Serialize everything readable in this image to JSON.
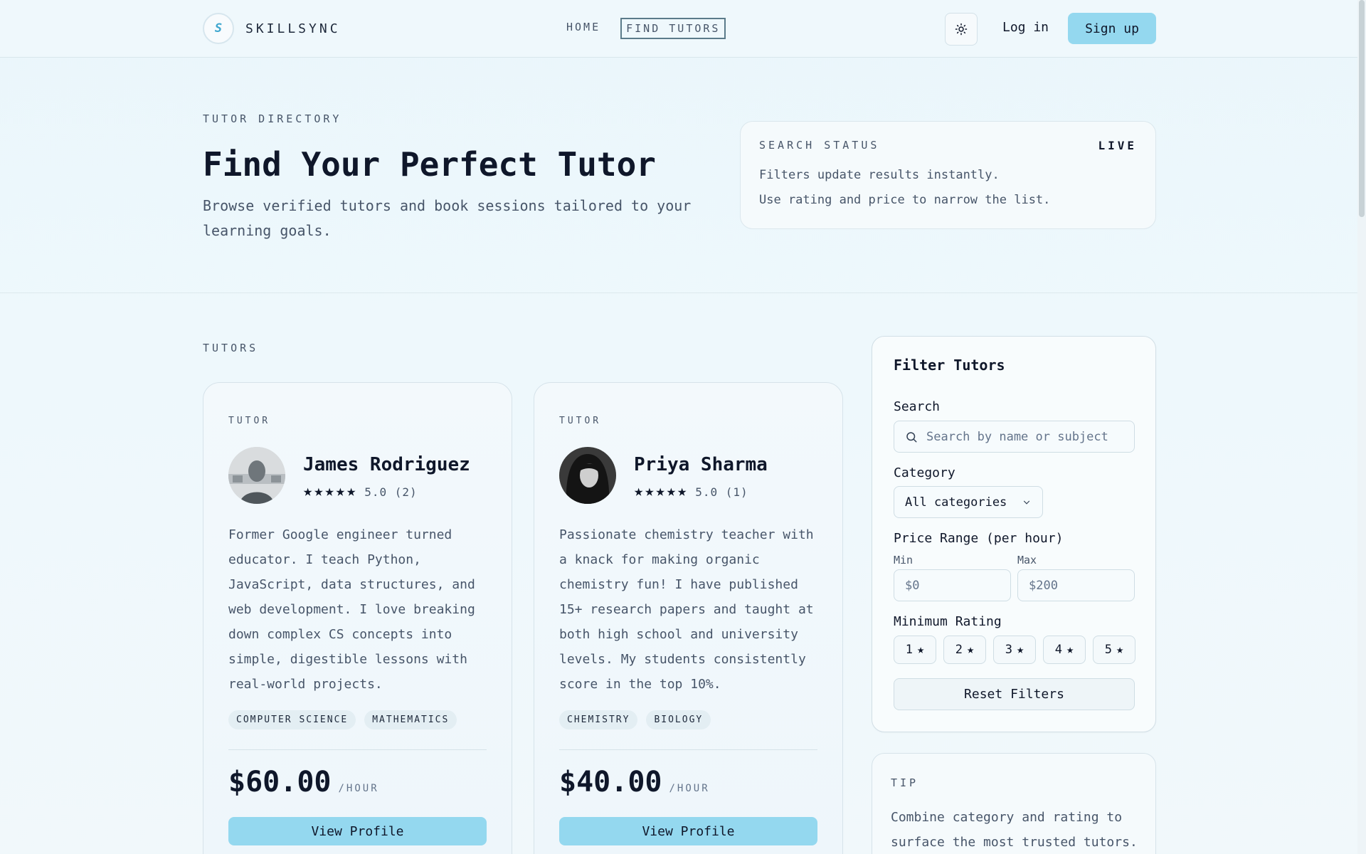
{
  "brand": {
    "logo_letter": "S",
    "name": "SKILLSYNC"
  },
  "nav": {
    "links": [
      {
        "label": "HOME",
        "active": false
      },
      {
        "label": "FIND TUTORS",
        "active": true
      }
    ],
    "theme_icon": "sun-icon",
    "login_label": "Log in",
    "signup_label": "Sign up"
  },
  "hero": {
    "eyebrow": "TUTOR DIRECTORY",
    "title": "Find Your Perfect Tutor",
    "subtitle": "Browse verified tutors and book sessions tailored to your learning goals."
  },
  "status": {
    "label": "SEARCH STATUS",
    "state": "LIVE",
    "lines": [
      "Filters update results instantly.",
      "Use rating and price to narrow the list."
    ]
  },
  "tutors": {
    "section_label": "TUTORS",
    "cards": [
      {
        "eyebrow": "TUTOR",
        "name": "James Rodriguez",
        "stars": 5,
        "rating_text": "5.0 (2)",
        "bio": "Former Google engineer turned educator. I teach Python, JavaScript, data structures, and web development. I love breaking down complex CS concepts into simple, digestible lessons with real-world projects.",
        "tags": [
          "COMPUTER SCIENCE",
          "MATHEMATICS"
        ],
        "price": "$60.00",
        "price_unit": "/HOUR",
        "button_label": "View Profile"
      },
      {
        "eyebrow": "TUTOR",
        "name": "Priya Sharma",
        "stars": 5,
        "rating_text": "5.0 (1)",
        "bio": "Passionate chemistry teacher with a knack for making organic chemistry fun! I have published 15+ research papers and taught at both high school and university levels. My students consistently score in the top 10%.",
        "tags": [
          "CHEMISTRY",
          "BIOLOGY"
        ],
        "price": "$40.00",
        "price_unit": "/HOUR",
        "button_label": "View Profile"
      }
    ]
  },
  "filters": {
    "title": "Filter Tutors",
    "search_label": "Search",
    "search_placeholder": "Search by name or subject",
    "category_label": "Category",
    "category_value": "All categories",
    "price_label": "Price Range (per hour)",
    "min_label": "Min",
    "max_label": "Max",
    "min_placeholder": "$0",
    "max_placeholder": "$200",
    "rating_label": "Minimum Rating",
    "rating_options": [
      "1",
      "2",
      "3",
      "4",
      "5"
    ],
    "reset_label": "Reset Filters"
  },
  "tip": {
    "label": "TIP",
    "text": "Combine category and rating to surface the most trusted tutors."
  },
  "colors": {
    "accent": "#94d8ef",
    "text": "#0f172a",
    "muted": "#475569",
    "logo_accent": "#3fa7cf"
  }
}
